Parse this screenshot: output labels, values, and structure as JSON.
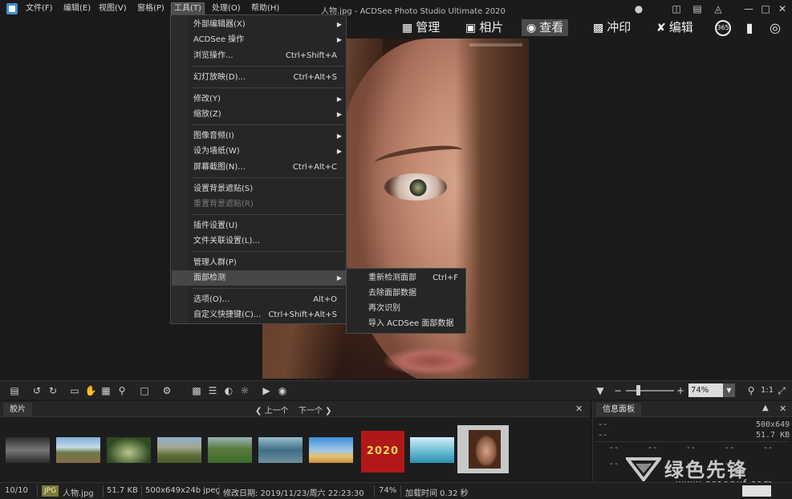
{
  "window": {
    "title": "人物.jpg - ACDSee Photo Studio Ultimate 2020",
    "controls": [
      "minimize",
      "maximize",
      "close"
    ]
  },
  "menubar": [
    {
      "label": "文件(F)"
    },
    {
      "label": "编辑(E)"
    },
    {
      "label": "视图(V)"
    },
    {
      "label": "窗格(P)"
    },
    {
      "label": "工具(T)"
    },
    {
      "label": "处理(O)"
    },
    {
      "label": "帮助(H)"
    }
  ],
  "modes": {
    "manage": "管理",
    "photos": "相片",
    "view": "查看",
    "develop": "冲印",
    "edit": "编辑",
    "icon_365": "365"
  },
  "tools_menu": {
    "items": [
      {
        "label": "外部编辑器(X)",
        "shortcut": "",
        "submenu": true,
        "disabled": false
      },
      {
        "label": "ACDSee 操作",
        "shortcut": "",
        "submenu": true,
        "disabled": false
      },
      {
        "label": "浏览操作...",
        "shortcut": "Ctrl+Shift+A",
        "submenu": false,
        "disabled": false
      },
      {
        "label": "幻灯放映(D)...",
        "shortcut": "Ctrl+Alt+S",
        "submenu": false,
        "disabled": false
      },
      {
        "label": "修改(Y)",
        "shortcut": "",
        "submenu": true,
        "disabled": false
      },
      {
        "label": "缩放(Z)",
        "shortcut": "",
        "submenu": true,
        "disabled": false
      },
      {
        "label": "图像音频(I)",
        "shortcut": "",
        "submenu": true,
        "disabled": false
      },
      {
        "label": "设为墙纸(W)",
        "shortcut": "",
        "submenu": true,
        "disabled": false
      },
      {
        "label": "屏幕截图(N)...",
        "shortcut": "Ctrl+Alt+C",
        "submenu": false,
        "disabled": false
      },
      {
        "label": "设置背景遮贴(S)",
        "shortcut": "",
        "submenu": false,
        "disabled": false
      },
      {
        "label": "重置背景遮贴(R)",
        "shortcut": "",
        "submenu": false,
        "disabled": true
      },
      {
        "label": "插件设置(U)",
        "shortcut": "",
        "submenu": false,
        "disabled": false
      },
      {
        "label": "文件关联设置(L)...",
        "shortcut": "",
        "submenu": false,
        "disabled": false
      },
      {
        "label": "管理人群(P)",
        "shortcut": "",
        "submenu": false,
        "disabled": false
      },
      {
        "label": "面部检测",
        "shortcut": "",
        "submenu": true,
        "disabled": false,
        "highlighted": true
      },
      {
        "label": "选项(O)...",
        "shortcut": "Alt+O",
        "submenu": false,
        "disabled": false
      },
      {
        "label": "自定义快捷键(C)...",
        "shortcut": "Ctrl+Shift+Alt+S",
        "submenu": false,
        "disabled": false
      }
    ]
  },
  "face_detection_submenu": {
    "items": [
      {
        "label": "重新检测面部",
        "shortcut": "Ctrl+F"
      },
      {
        "label": "去除面部数据",
        "shortcut": ""
      },
      {
        "label": "再次识别",
        "shortcut": ""
      },
      {
        "label": "导入 ACDSee 面部数据",
        "shortcut": ""
      }
    ]
  },
  "zoom": {
    "value": "74%",
    "level_percent": 74,
    "one_to_one": "1:1"
  },
  "filmstrip": {
    "tab": "胶片",
    "prev": "上一个",
    "next": "下一个",
    "thumb_count": 10,
    "selected_index": 9,
    "thumb_banner_text": "2020"
  },
  "info_panel": {
    "tab": "信息面板",
    "rows": [
      {
        "left": "--",
        "right": "500x649"
      },
      {
        "left": "--",
        "right": "51.7 KB"
      }
    ],
    "grid_cells": [
      "--",
      "--",
      "--",
      "--",
      "--",
      "--",
      "--",
      "--",
      "--"
    ]
  },
  "watermark": {
    "text": "绿色先锋",
    "url": "www.greenxf.com"
  },
  "statusbar": {
    "index": "10/10",
    "format": "JPG",
    "filename": "人物.jpg",
    "filesize": "51.7 KB",
    "dims": "500x649x24b jpeg",
    "modified": "修改日期: 2019/11/23/周六 22:23:30",
    "zoom": "74%",
    "load_time": "加载时间 0.32 秒"
  },
  "colors": {
    "background": "#1b1b1b",
    "menu_bg": "#262626",
    "highlight": "#474747",
    "status_jpg": "#7a7a3a"
  }
}
